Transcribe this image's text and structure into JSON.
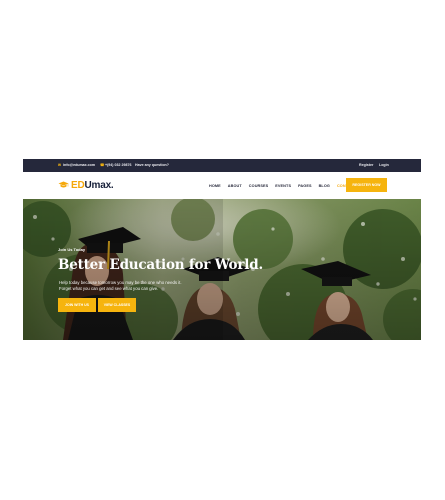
{
  "topbar": {
    "email": "info@edumax.com",
    "phone": "+(94) 032 29876",
    "question": "Have any question?",
    "register": "Register",
    "login": "Login"
  },
  "header": {
    "logo_text_first": "ED",
    "logo_text_rest": "Umax.",
    "nav": [
      "HOME",
      "ABOUT",
      "COURSES",
      "EVENTS",
      "PAGES",
      "BLOG",
      "CONTACT"
    ],
    "active_nav": "CONTACT",
    "register_button": "REGISTER NOW"
  },
  "hero": {
    "eyebrow": "Join Us Today",
    "headline": "Better Education for World.",
    "description": [
      "Help today because tomorrow you may be the one who needs it.",
      "Forget what you can get and see what you can give."
    ],
    "primary_button": "JOIN WITH US",
    "secondary_button": "VIEW CLASSES"
  },
  "colors": {
    "accent": "#f6b40e",
    "topbar_bg": "#25283b",
    "heading_dark": "#17203a"
  },
  "icons": [
    "email-icon",
    "phone-icon",
    "graduation-cap-logo-icon"
  ]
}
